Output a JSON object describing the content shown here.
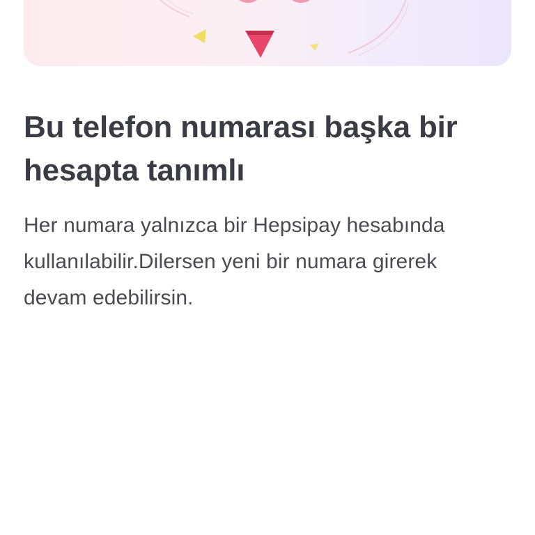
{
  "hero": {
    "illustration": "phone-conflict-illustration",
    "colors": {
      "gradient_start": "#fdecef",
      "gradient_end": "#ebe6fb",
      "pink": "#e9466a",
      "yellow": "#f3dd5c"
    }
  },
  "message": {
    "title": "Bu telefon numarası başka bir hesapta tanımlı",
    "description": "Her numara yalnızca bir Hepsipay hesabında kullanılabilir.Dilersen yeni bir numara girerek devam edebilirsin."
  },
  "colors": {
    "title": "#3b3b44",
    "body": "#4a4a52",
    "background": "#ffffff"
  }
}
